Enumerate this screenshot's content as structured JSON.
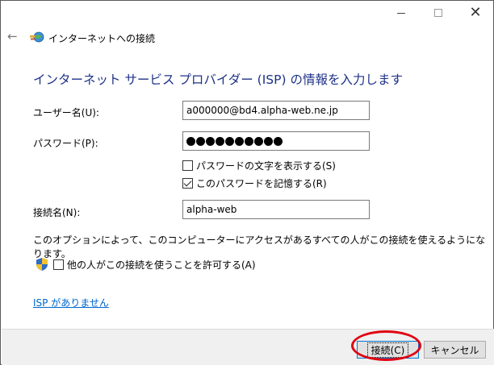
{
  "wizard": {
    "title": "インターネットへの接続",
    "heading": "インターネット サービス プロバイダー (ISP) の情報を入力します"
  },
  "form": {
    "username_label": "ユーザー名(U):",
    "username_value": "a000000@bd4.alpha-web.ne.jp",
    "password_label": "パスワード(P):",
    "password_mask_count": 10,
    "show_password_label": "パスワードの文字を表示する(S)",
    "show_password_checked": false,
    "remember_password_label": "このパスワードを記憶する(R)",
    "remember_password_checked": true,
    "connection_name_label": "接続名(N):",
    "connection_name_value": "alpha-web"
  },
  "info_text": "このオプションによって、このコンピューターにアクセスがあるすべての人がこの接続を使えるようになります。",
  "allow_others": {
    "label": "他の人がこの接続を使うことを許可する(A)",
    "checked": false
  },
  "no_isp_link": "ISP がありません",
  "buttons": {
    "connect": "接続(C)",
    "cancel": "キャンセル"
  },
  "titlebar": {
    "minimize_icon": "minimize-icon",
    "maximize_icon": "maximize-icon",
    "close_icon": "close-icon"
  },
  "colors": {
    "heading": "#1e3287",
    "link": "#0066cc",
    "highlight_oval": "#e0000f"
  }
}
